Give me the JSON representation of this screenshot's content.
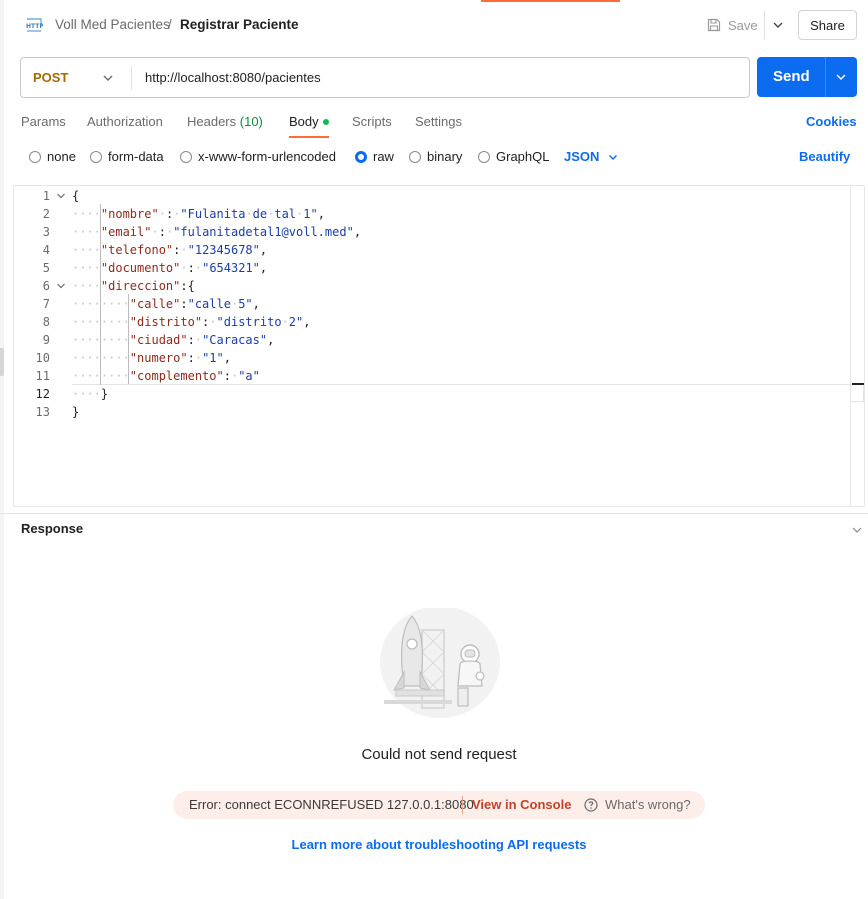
{
  "header": {
    "icon": "http-icon",
    "breadcrumb_parent": "Voll Med Pacientes",
    "breadcrumb_separator": "/",
    "breadcrumb_current": "Registrar Paciente",
    "save_label": "Save",
    "share_label": "Share"
  },
  "request": {
    "method": "POST",
    "url": "http://localhost:8080/pacientes",
    "send_label": "Send"
  },
  "tabs": {
    "params": "Params",
    "authorization": "Authorization",
    "headers": "Headers",
    "headers_count": "(10)",
    "body": "Body",
    "scripts": "Scripts",
    "settings": "Settings",
    "active": "Body",
    "cookies": "Cookies"
  },
  "body_types": {
    "none": "none",
    "form_data": "form-data",
    "urlencoded": "x-www-form-urlencoded",
    "raw": "raw",
    "binary": "binary",
    "graphql": "GraphQL",
    "selected": "raw",
    "language": "JSON",
    "beautify": "Beautify"
  },
  "editor": {
    "current_line": 12,
    "lines": [
      {
        "n": "1",
        "indent": 0,
        "text": "{"
      },
      {
        "n": "2",
        "indent": 1,
        "key": "nombre",
        "sep": " : ",
        "value": "Fulanita de tal 1",
        "tail": ","
      },
      {
        "n": "3",
        "indent": 1,
        "key": "email",
        "sep": " : ",
        "value": "fulanitadetal1@voll.med",
        "tail": ","
      },
      {
        "n": "4",
        "indent": 1,
        "key": "telefono",
        "sep": ": ",
        "value": "12345678",
        "tail": ","
      },
      {
        "n": "5",
        "indent": 1,
        "key": "documento",
        "sep": " : ",
        "value": "654321",
        "tail": ","
      },
      {
        "n": "6",
        "indent": 1,
        "key": "direccion",
        "sep": ":",
        "open": "{"
      },
      {
        "n": "7",
        "indent": 2,
        "key": "calle",
        "sep": ":",
        "value": "calle 5",
        "tail": ","
      },
      {
        "n": "8",
        "indent": 2,
        "key": "distrito",
        "sep": ": ",
        "value": "distrito 2",
        "tail": ","
      },
      {
        "n": "9",
        "indent": 2,
        "key": "ciudad",
        "sep": ": ",
        "value": "Caracas",
        "tail": ","
      },
      {
        "n": "10",
        "indent": 2,
        "key": "numero",
        "sep": ": ",
        "value": "1",
        "tail": ","
      },
      {
        "n": "11",
        "indent": 2,
        "key": "complemento",
        "sep": ": ",
        "value": "a"
      },
      {
        "n": "12",
        "indent": 1,
        "text": "}"
      },
      {
        "n": "13",
        "indent": 0,
        "text": "}"
      }
    ]
  },
  "response": {
    "title": "Response",
    "message": "Could not send request",
    "error": "Error: connect ECONNREFUSED 127.0.0.1:8080",
    "view_console": "View in Console",
    "whats_wrong": "What's wrong?",
    "learn_more": "Learn more about troubleshooting API requests"
  },
  "colors": {
    "accent": "#ff6c37",
    "primary": "#0b6cf0",
    "method_post": "#a56a00",
    "json_key": "#8e2a1f",
    "json_string": "#1a3ea8",
    "error_bg": "#fdeeea",
    "error_link": "#c1432a"
  }
}
